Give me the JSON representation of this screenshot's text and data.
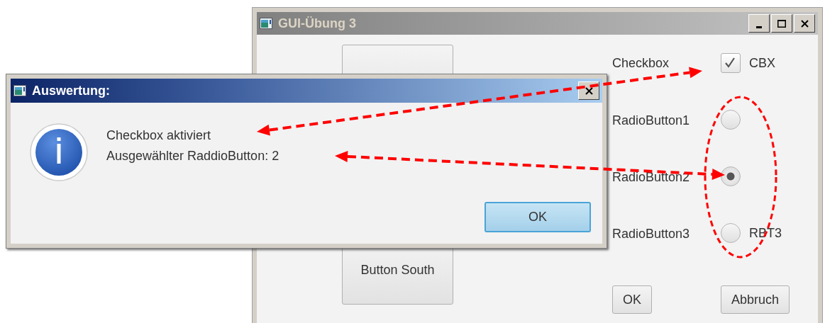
{
  "main_window": {
    "title": "GUI-Übung 3",
    "south_button": "Button South",
    "checkbox": {
      "label": "Checkbox",
      "text": "CBX",
      "checked": true
    },
    "radios": [
      {
        "label": "RadioButton1",
        "selected": false
      },
      {
        "label": "RadioButton2",
        "selected": true
      },
      {
        "label": "RadioButton3",
        "text": "RBT3",
        "selected": false
      }
    ],
    "actions": [
      "OK",
      "Abbruch"
    ]
  },
  "dialog": {
    "title": "Auswertung:",
    "lines": [
      "Checkbox aktiviert",
      "Ausgewählter RaddioButton: 2"
    ],
    "button": "OK"
  }
}
